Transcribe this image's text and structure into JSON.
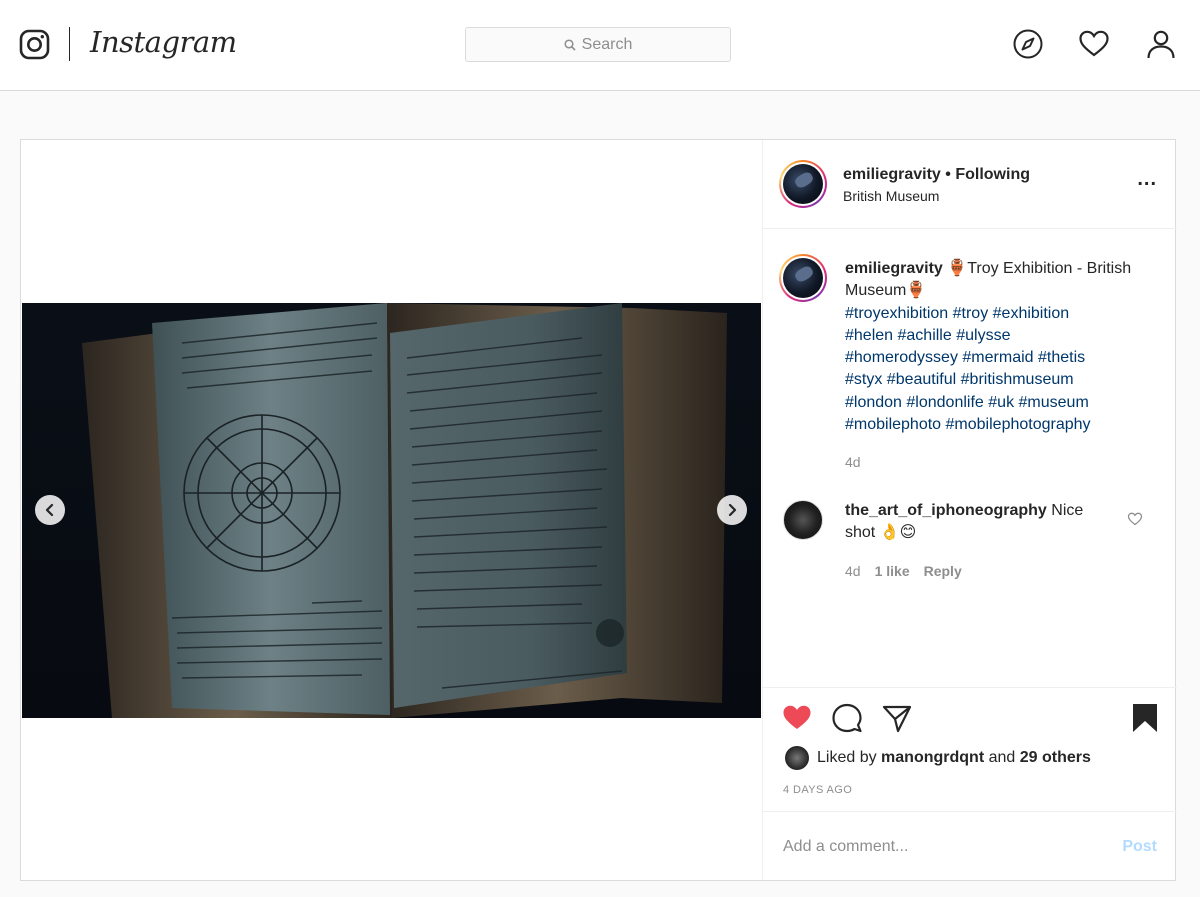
{
  "header": {
    "brand": "Instagram",
    "search_placeholder": "Search",
    "icons": [
      "instagram-logo-icon",
      "search-icon",
      "explore-compass-icon",
      "activity-heart-icon",
      "profile-icon"
    ]
  },
  "post": {
    "author": {
      "username": "emiliegravity",
      "separator": "•",
      "follow_status": "Following",
      "location": "British Museum"
    },
    "more_label": "...",
    "caption": {
      "username": "emiliegravity",
      "text_start": "🏺Troy Exhibition - British Museum🏺",
      "hashtags": [
        "#troyexhibition",
        "#troy",
        "#exhibition",
        "#helen",
        "#achille",
        "#ulysse",
        "#homerodyssey",
        "#mermaid",
        "#thetis",
        "#styx",
        "#beautiful",
        "#britishmuseum",
        "#london",
        "#londonlife",
        "#uk",
        "#museum",
        "#mobilephoto",
        "#mobilephotography"
      ],
      "time": "4d"
    },
    "comment": {
      "username": "the_art_of_iphoneography",
      "text": "Nice shot 👌😊",
      "time": "4d",
      "likes": "1 like",
      "reply_label": "Reply"
    },
    "likes": {
      "prefix": "Liked by",
      "user": "manongrdqnt",
      "joiner": "and",
      "others": "29 others"
    },
    "posted_ago": "4 DAYS AGO",
    "add_comment_placeholder": "Add a comment...",
    "post_label": "Post",
    "liked": true,
    "saved": true
  },
  "colors": {
    "like_red": "#ed4956",
    "hashtag_blue": "#00376b",
    "border": "#dbdbdb",
    "muted": "#8e8e8e",
    "post_button_disabled": "#b3dbff"
  }
}
